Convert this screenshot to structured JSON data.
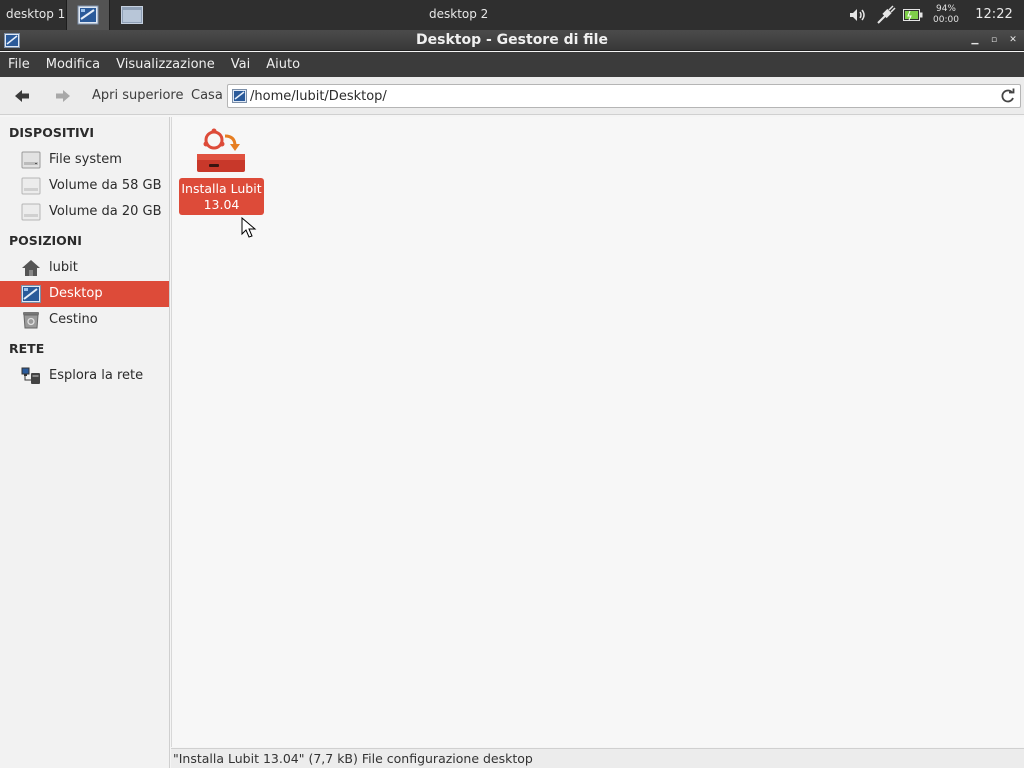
{
  "panel": {
    "workspace1": "desktop 1",
    "workspace2": "desktop 2",
    "battery_percent": "94%",
    "battery_time": "00:00",
    "clock": "12:22"
  },
  "window": {
    "title": "Desktop - Gestore di file"
  },
  "menubar": {
    "items": [
      "File",
      "Modifica",
      "Visualizzazione",
      "Vai",
      "Aiuto"
    ]
  },
  "toolbar": {
    "up_label": "Apri superiore",
    "home_label": "Casa",
    "path": "/home/lubit/Desktop/"
  },
  "sidebar": {
    "sections": [
      {
        "title": "DISPOSITIVI",
        "items": [
          {
            "label": "File system",
            "icon": "drive-icon"
          },
          {
            "label": "Volume da 58 GB",
            "icon": "drive-icon"
          },
          {
            "label": "Volume da 20 GB",
            "icon": "drive-icon"
          }
        ]
      },
      {
        "title": "POSIZIONI",
        "items": [
          {
            "label": "lubit",
            "icon": "home-icon"
          },
          {
            "label": "Desktop",
            "icon": "desktop-icon",
            "selected": true
          },
          {
            "label": "Cestino",
            "icon": "trash-icon"
          }
        ]
      },
      {
        "title": "RETE",
        "items": [
          {
            "label": "Esplora la rete",
            "icon": "network-icon"
          }
        ]
      }
    ]
  },
  "files": [
    {
      "name_line1": "Installa Lubit",
      "name_line2": "13.04",
      "icon": "installer-icon",
      "selected": true
    }
  ],
  "statusbar": {
    "text": "\"Installa Lubit 13.04\" (7,7 kB) File configurazione desktop"
  },
  "colors": {
    "accent": "#dd4b39",
    "panel": "#2f2f2f",
    "titlebar": "#3f3f3f",
    "menubar": "#3b3b3b"
  }
}
